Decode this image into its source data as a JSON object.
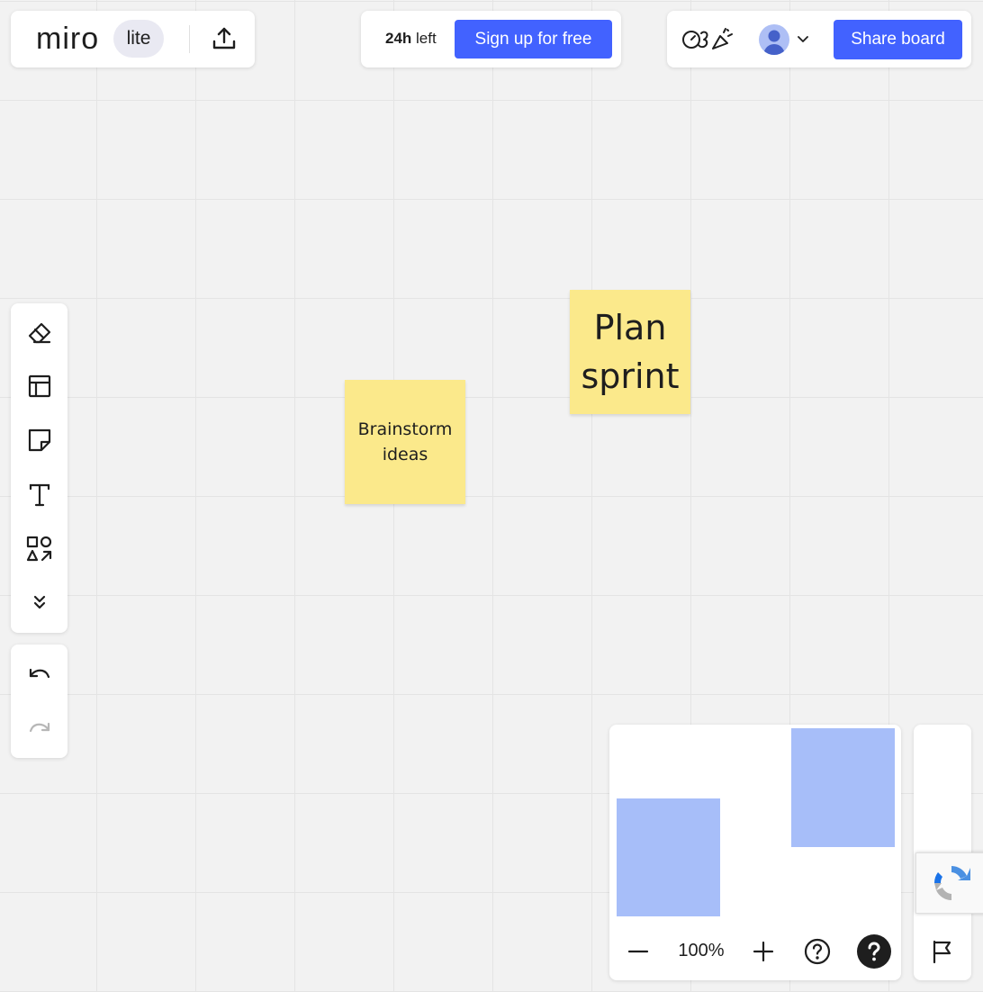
{
  "app": {
    "logo_text": "miro",
    "badge": "lite"
  },
  "trial": {
    "time_value": "24h",
    "time_suffix": " left",
    "signup_label": "Sign up for free"
  },
  "header_right": {
    "share_label": "Share board",
    "avatar_icon": "user-avatar",
    "reactions_icon": "timer-emote-confetti"
  },
  "toolbar": {
    "tools": [
      "eraser-icon",
      "frame-template-icon",
      "sticky-note-icon",
      "text-icon",
      "shapes-icon",
      "more-tools-icon"
    ],
    "history": [
      "undo-icon",
      "redo-icon"
    ]
  },
  "board": {
    "stickies": [
      {
        "text": "Brainstorm ideas"
      },
      {
        "text": "Plan sprint"
      }
    ]
  },
  "zoom": {
    "level": "100%"
  },
  "colors": {
    "accent": "#4262ff",
    "sticky_yellow": "#fbe98b",
    "minimap_shape": "#a7bef9",
    "canvas_bg": "#f2f2f2"
  }
}
